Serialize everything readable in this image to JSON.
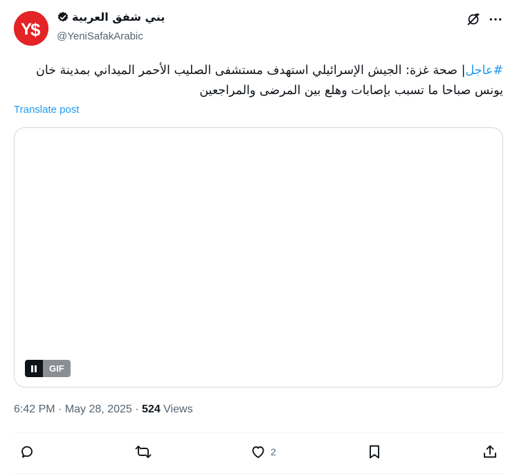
{
  "author": {
    "display_name": "يني شفق العربية",
    "handle": "@YeniSafakArabic",
    "verified": true
  },
  "post": {
    "hashtag": "#عاجل",
    "text_rest": "| صحة غزة: الجيش الإسرائيلي استهدف مستشفى الصليب الأحمر الميداني بمدينة خان يونس صباحا ما تسبب بإصابات وهلع بين المرضى والمراجعين",
    "translate_label": "Translate post"
  },
  "media": {
    "badge": "GIF"
  },
  "meta": {
    "time": "6:42 PM",
    "separator": "·",
    "date": "May 28, 2025",
    "views_count": "524",
    "views_label": "Views"
  },
  "actions": {
    "reply_count": "",
    "repost_count": "",
    "like_count": "2"
  },
  "colors": {
    "accent": "#1d9bf0",
    "brand_avatar": "#e32326",
    "muted_text": "#536471"
  }
}
